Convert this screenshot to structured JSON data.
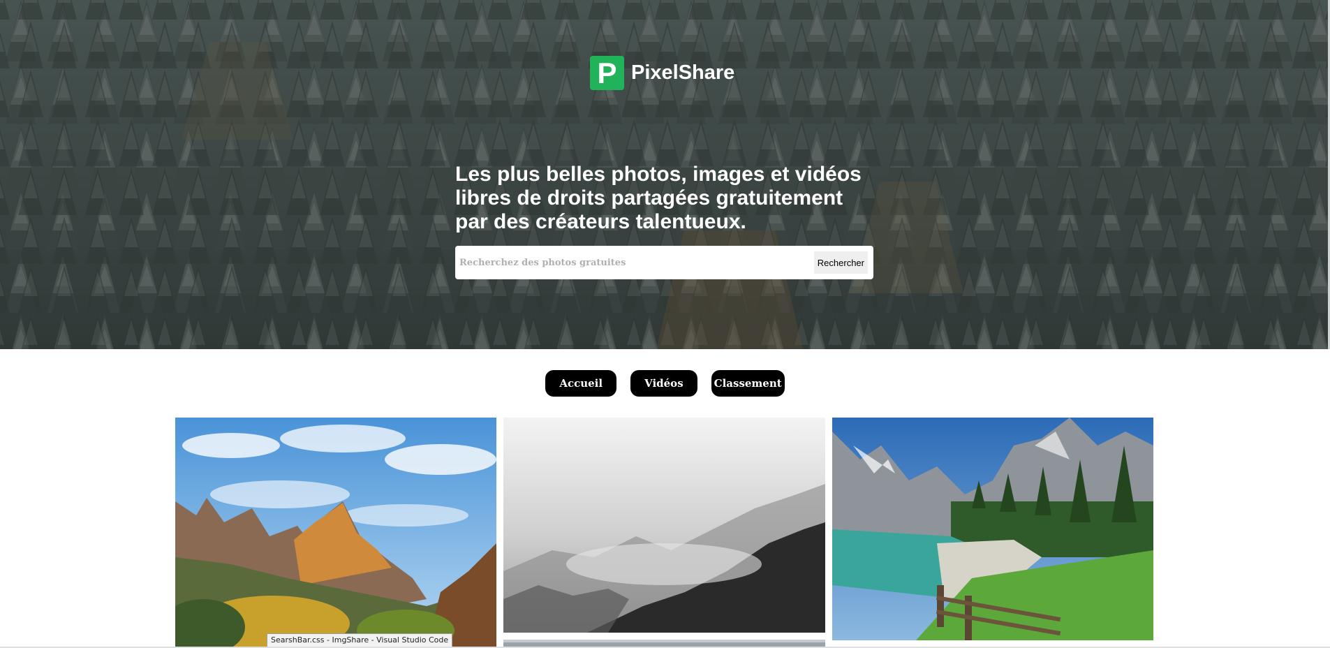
{
  "brand": {
    "logo_letter": "P",
    "name": "PixelShare",
    "logo_color": "#21b35a"
  },
  "hero": {
    "headline": "Les plus belles photos, images et vidéos libres de droits partagées gratuitement par des créateurs talentueux.",
    "background": "snowy-pine-forest-photo"
  },
  "search": {
    "placeholder": "Recherchez des photos gratuites",
    "value": "",
    "button_label": "Rechercher"
  },
  "nav": {
    "items": [
      {
        "label": "Accueil"
      },
      {
        "label": "Vidéos"
      },
      {
        "label": "Classement"
      }
    ]
  },
  "gallery": {
    "photos": [
      {
        "subject": "desert-canyon-mountains-blue-sky"
      },
      {
        "subject": "misty-forest-hills-black-and-white"
      },
      {
        "subject": "alpine-lake-meadow-wooden-fence"
      },
      {
        "subject": "cloudy-landscape"
      }
    ]
  },
  "tooltip": {
    "text": "SearshBar.css - ImgShare - Visual Studio Code"
  }
}
